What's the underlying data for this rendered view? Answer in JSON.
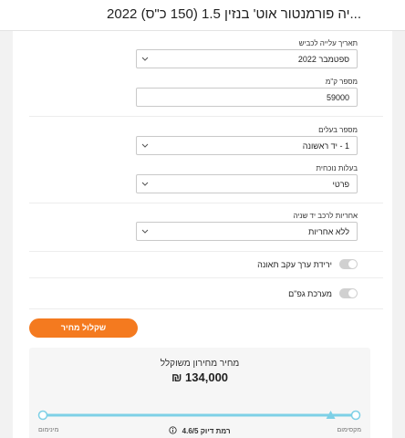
{
  "header": {
    "title": "...יה פורמנטור אוט' בנזין 1.5 (150 כ\"ס) 2022"
  },
  "fields": {
    "road_date": {
      "label": "תאריך עלייה לכביש",
      "value": "ספטמבר 2022"
    },
    "km": {
      "label": "מספר ק\"מ",
      "value": "59000"
    },
    "owners": {
      "label": "מספר בעלים",
      "value": "1 - יד ראשונה"
    },
    "ownership": {
      "label": "בעלות נוכחית",
      "value": "פרטי"
    },
    "warranty": {
      "label": "אחריות לרכב יד שניה",
      "value": "ללא אחריות"
    }
  },
  "toggles": {
    "accident": {
      "label": "ירידת ערך עקב תאונה",
      "on": false
    },
    "body": {
      "label": "מערכת גפ\"ם",
      "on": false
    }
  },
  "button": {
    "label": "שקלול מחיר"
  },
  "price": {
    "label": "מחיר מחירון משוקלל",
    "value": "134,000 ₪",
    "max_label": "מקסימום",
    "min_label": "מינימום",
    "accuracy_text": "רמת דיוק 4.6/5",
    "accuracy_fraction": 0.92
  },
  "colors": {
    "accent": "#f47a1f",
    "scale": "#7dd0e6"
  },
  "icons": [
    "chevron-down-icon",
    "info-icon"
  ]
}
